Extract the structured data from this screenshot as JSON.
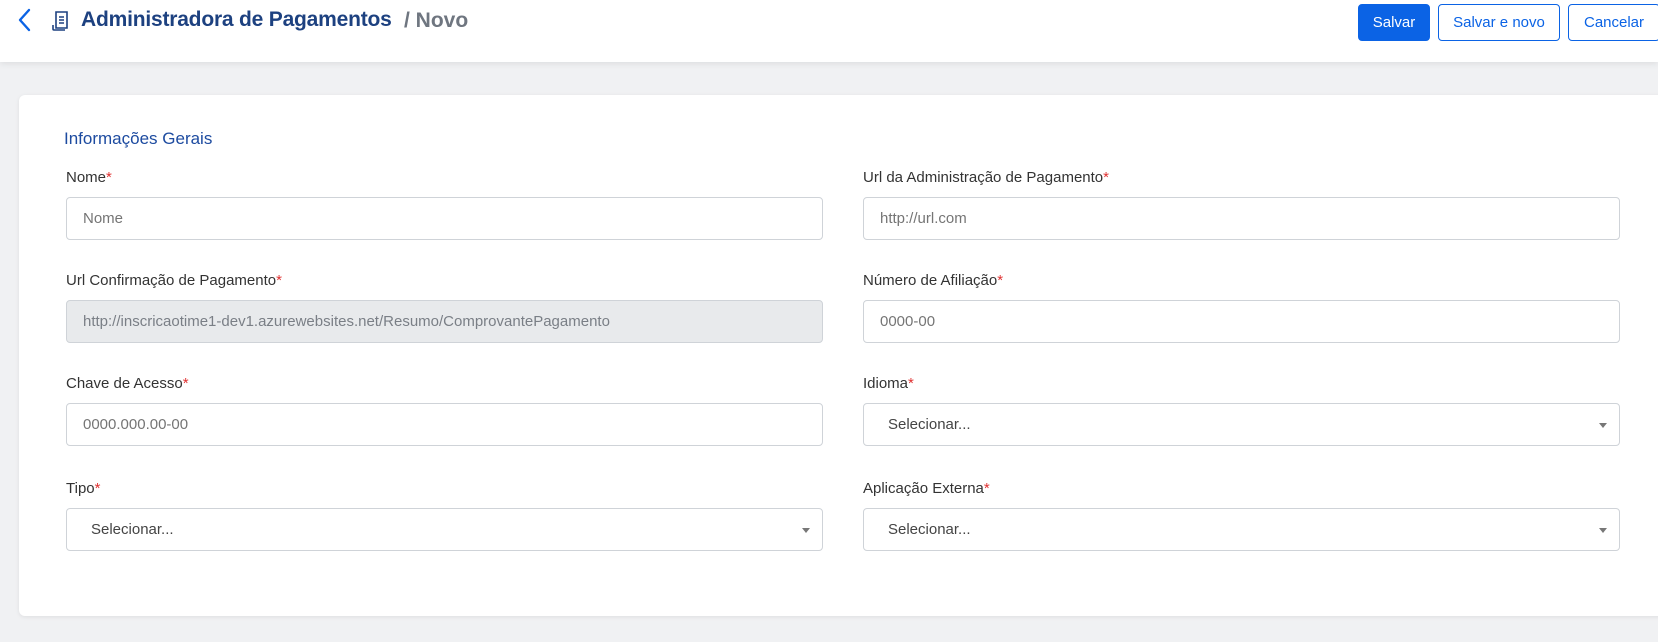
{
  "header": {
    "title": "Administradora de Pagamentos",
    "subtitle": "/ Novo",
    "back_icon": "chevron-left-icon",
    "page_icon": "document-icon"
  },
  "actions": {
    "save": "Salvar",
    "save_and_new": "Salvar e novo",
    "cancel": "Cancelar"
  },
  "form": {
    "section_title": "Informações Gerais",
    "required_mark": "*",
    "nome": {
      "label": "Nome",
      "placeholder": "Nome"
    },
    "url_admin": {
      "label": "Url da Administração de Pagamento",
      "placeholder": "http://url.com"
    },
    "url_confirmacao": {
      "label": "Url Confirmação de Pagamento",
      "value": "http://inscricaotime1-dev1.azurewebsites.net/Resumo/ComprovantePagamento"
    },
    "numero_afiliacao": {
      "label": "Número de Afiliação",
      "placeholder": "0000-00"
    },
    "chave_acesso": {
      "label": "Chave de Acesso",
      "placeholder": "0000.000.00-00"
    },
    "idioma": {
      "label": "Idioma",
      "selected": "Selecionar..."
    },
    "tipo": {
      "label": "Tipo",
      "selected": "Selecionar..."
    },
    "aplicacao_externa": {
      "label": "Aplicação Externa",
      "selected": "Selecionar..."
    }
  },
  "colors": {
    "primary": "#0b63e5",
    "title": "#1d4180",
    "required": "#e03131"
  }
}
